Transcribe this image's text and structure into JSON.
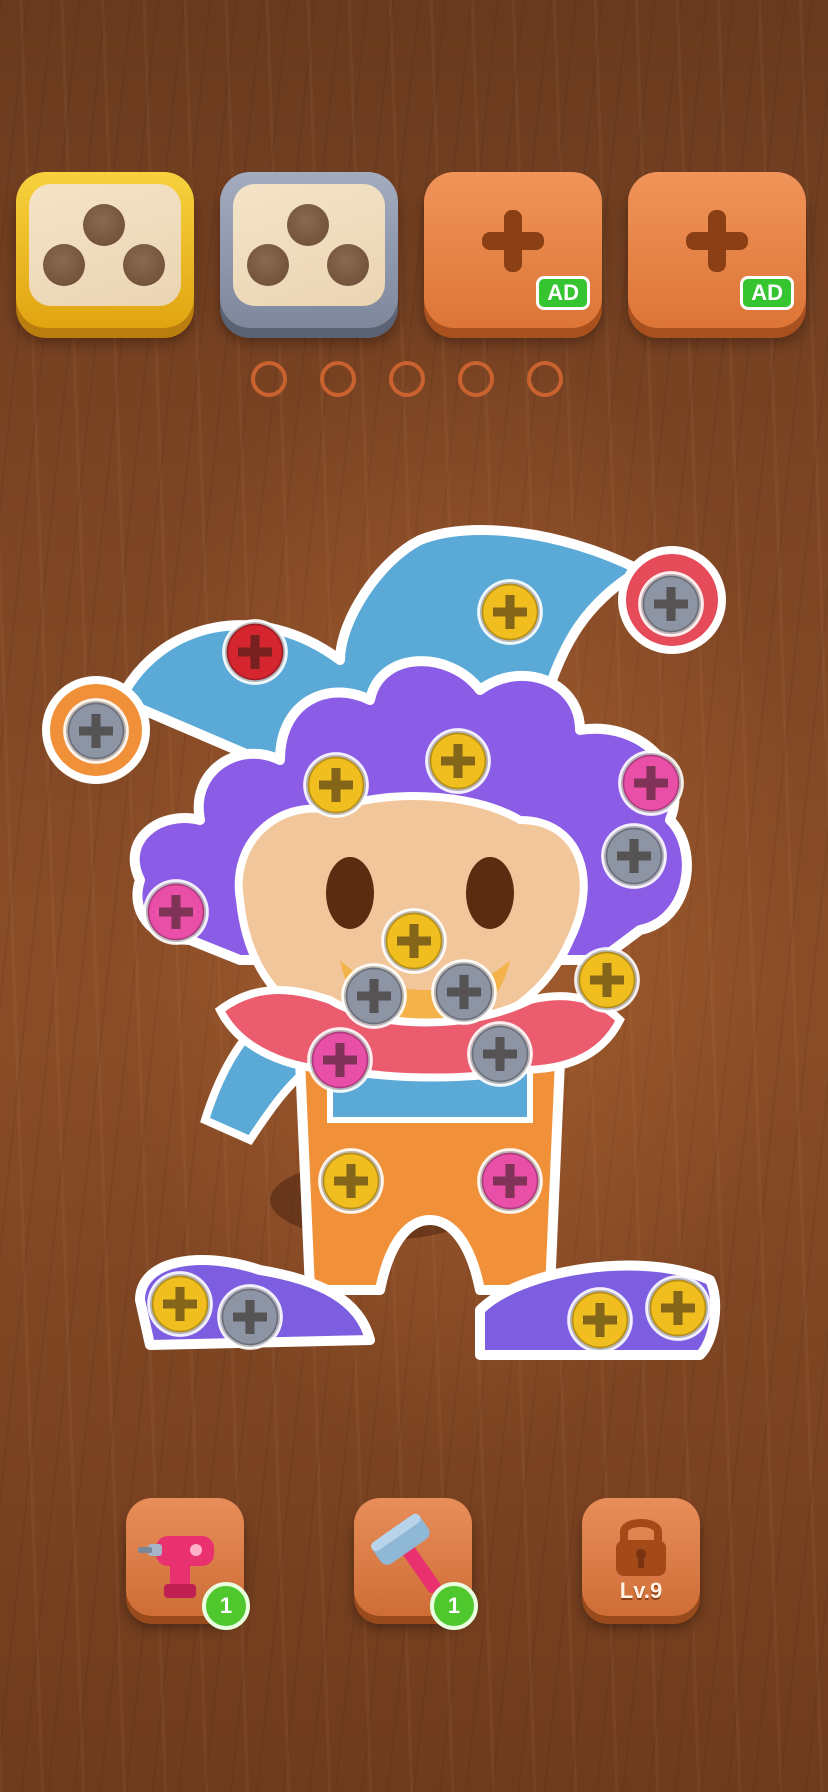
{
  "screw_boxes": [
    {
      "style": "gold",
      "holes": 3
    },
    {
      "style": "gray",
      "holes": 3
    },
    {
      "style": "orange-add",
      "badge": "AD",
      "icon": "plus-icon"
    },
    {
      "style": "orange-add",
      "badge": "AD",
      "icon": "plus-icon"
    }
  ],
  "holding_slots": 5,
  "screws": [
    {
      "color": "#d52630"
    },
    {
      "color": "#f1be1f"
    },
    {
      "color": "#8d94a3"
    },
    {
      "color": "#8d94a3"
    }
  ],
  "tools": [
    {
      "name": "drill",
      "icon": "drill-icon",
      "count": "1"
    },
    {
      "name": "hammer",
      "icon": "hammer-icon",
      "count": "1"
    },
    {
      "name": "locked",
      "icon": "lock-icon",
      "level": "Lv.9"
    }
  ],
  "colors": {
    "yellow_screw": "#f1be1f",
    "gray_screw": "#8d94a3",
    "pink_screw": "#ea4fa8",
    "red_screw": "#d52630",
    "hat_blue": "#5aa9d6",
    "hair_purple": "#8b5ce6",
    "pants_orange": "#f0913a"
  }
}
